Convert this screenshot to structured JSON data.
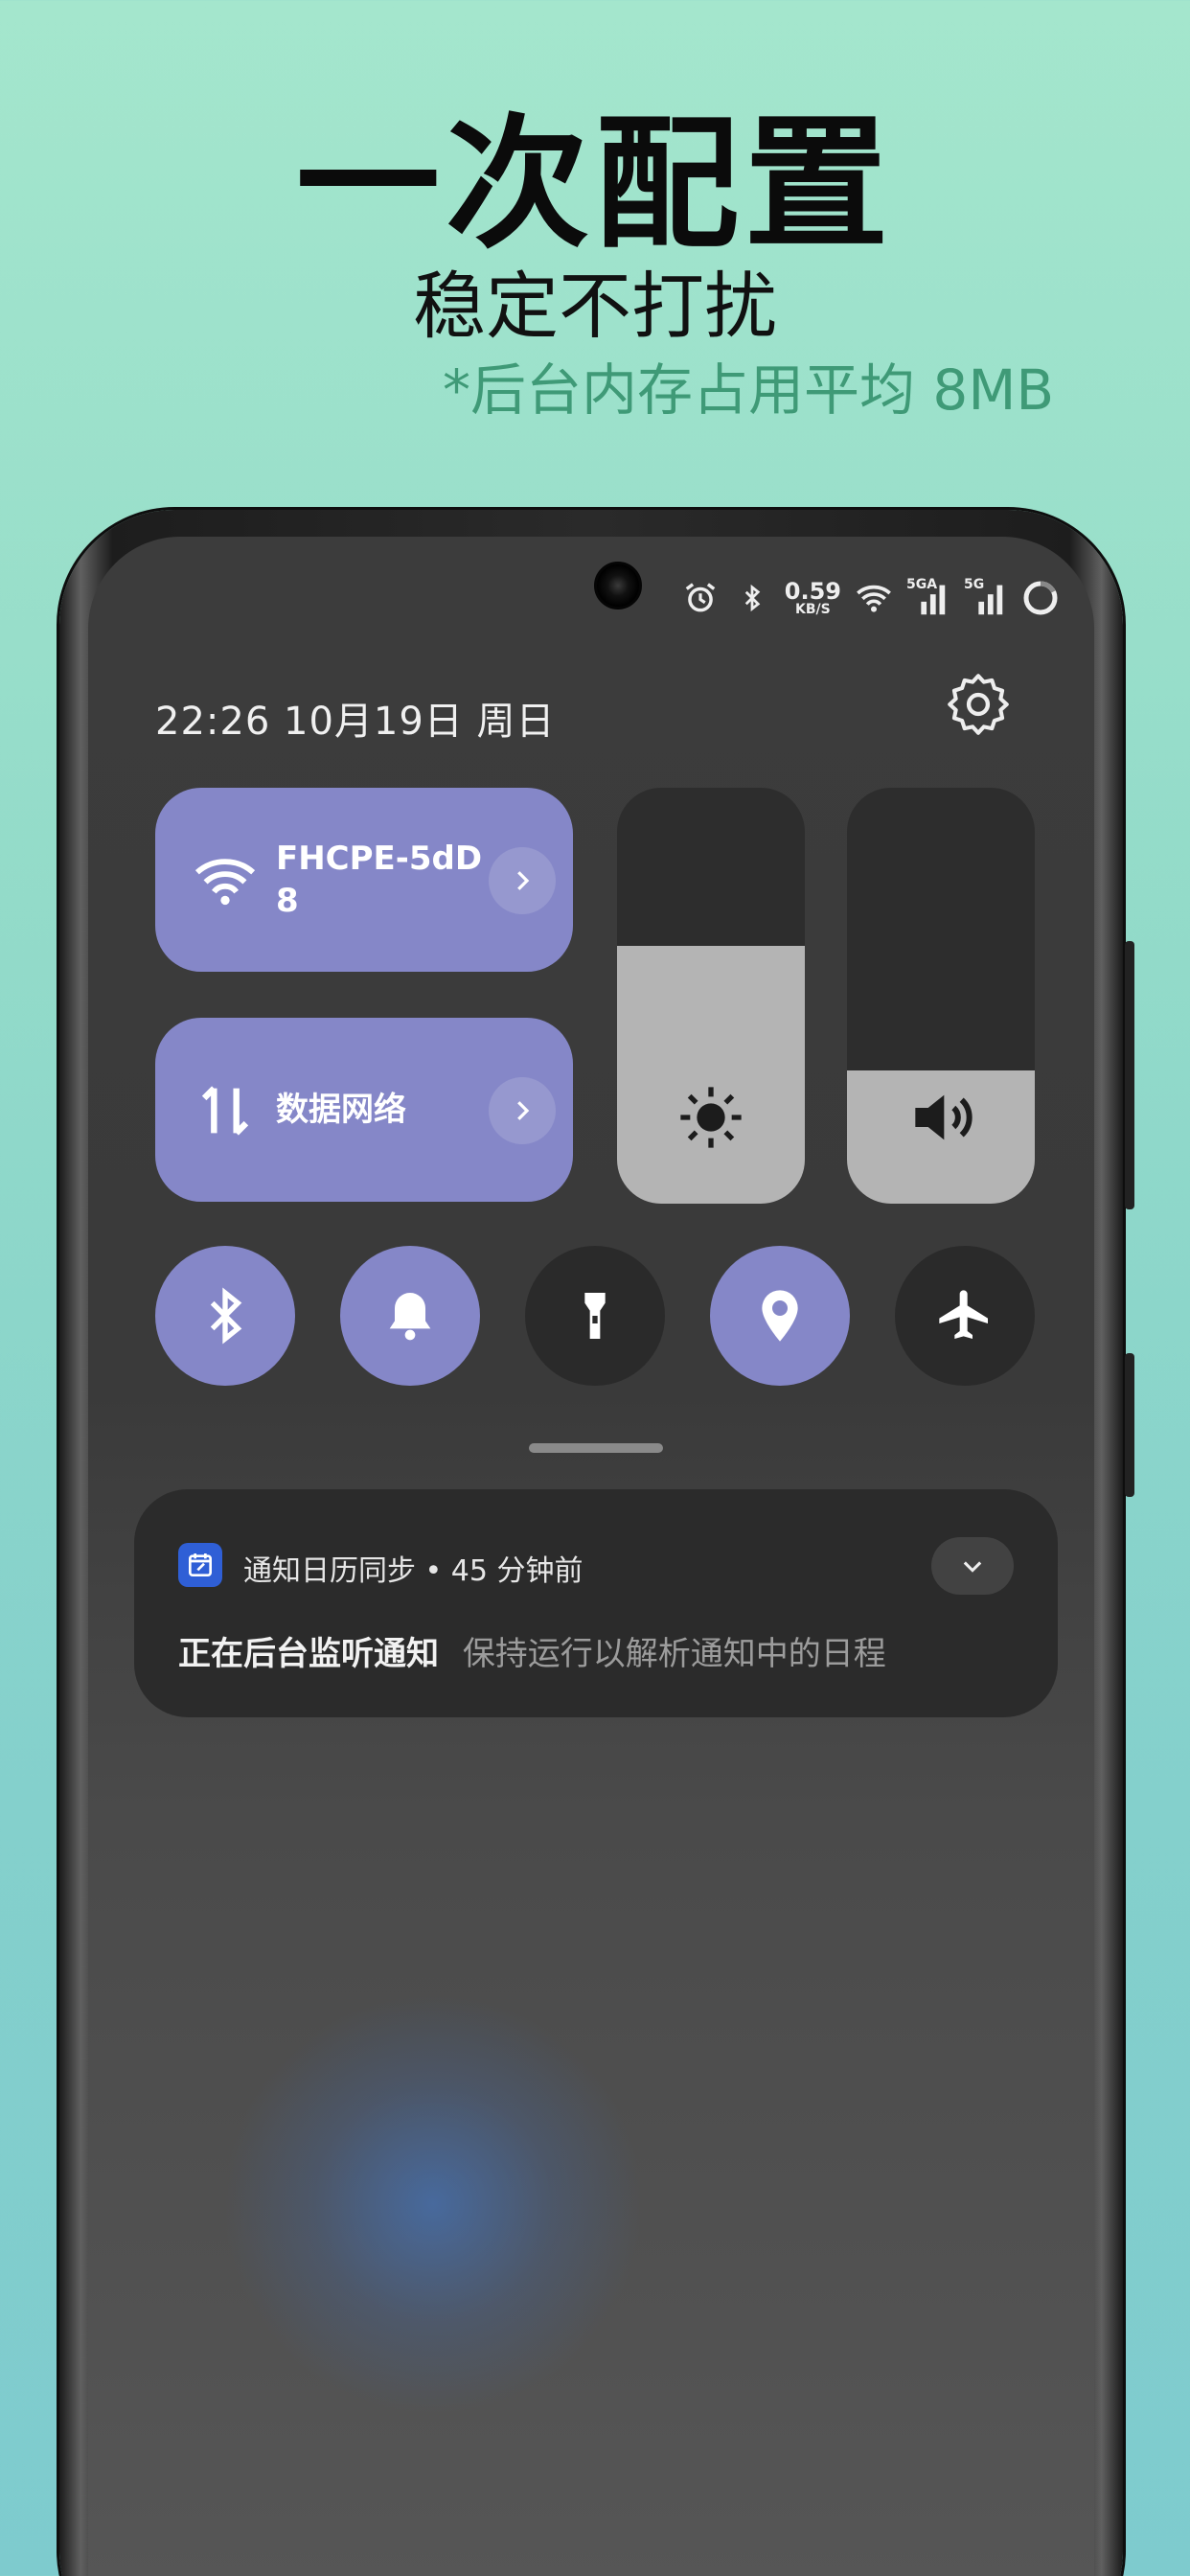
{
  "headline": "一次配置",
  "subheadline": "稳定不打扰",
  "tagline": "*后台内存占用平均 8MB",
  "status_bar": {
    "net_speed": "0.59",
    "net_speed_unit": "KB/S",
    "sim1_label": "5GA",
    "sim2_label": "5G",
    "icons": [
      "alarm-icon",
      "bluetooth-icon",
      "wifi-icon",
      "signal-icon",
      "signal-icon",
      "battery-ring-icon"
    ]
  },
  "header": {
    "time": "22:26",
    "date": "10月19日",
    "weekday": "周日"
  },
  "tiles": {
    "wifi": {
      "label": "FHCPE-5dD 8"
    },
    "data": {
      "label": "数据网络"
    }
  },
  "sliders": {
    "brightness": {
      "level": 0.62
    },
    "volume": {
      "level": 0.32
    }
  },
  "toggles": [
    {
      "name": "bluetooth",
      "on": true
    },
    {
      "name": "ring",
      "on": true
    },
    {
      "name": "flashlight",
      "on": false
    },
    {
      "name": "location",
      "on": true
    },
    {
      "name": "airplane",
      "on": false
    }
  ],
  "notification": {
    "app_name": "通知日历同步",
    "separator": "•",
    "time_ago": "45 分钟前",
    "title": "正在后台监听通知",
    "text": "保持运行以解析通知中的日程"
  },
  "colors": {
    "accent": "#8587c8",
    "background_top": "#a4e6cd",
    "background_bottom": "#7ecbce",
    "tagline": "#3f9a77",
    "app_icon": "#2f5fd6"
  }
}
